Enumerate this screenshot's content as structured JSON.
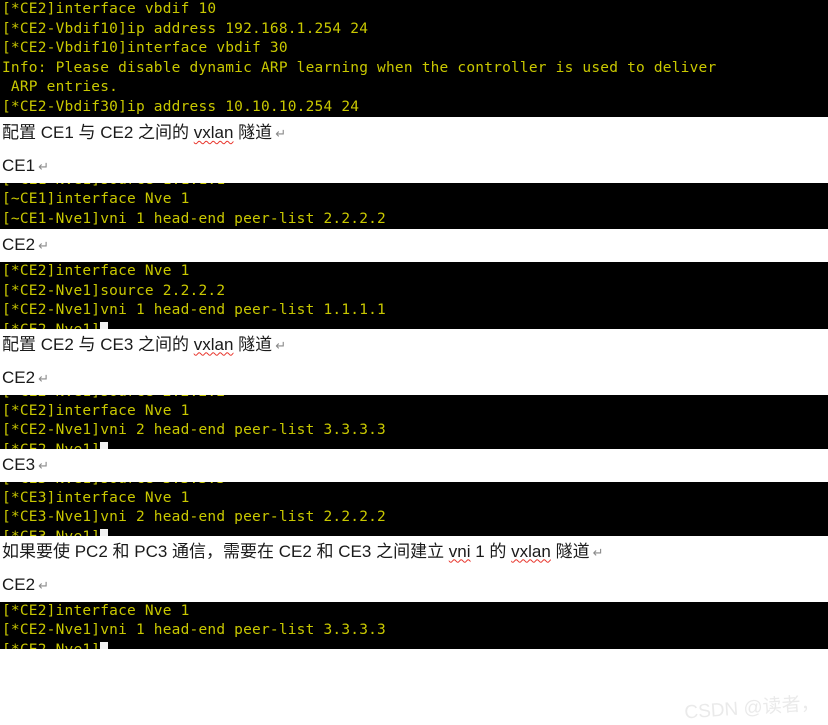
{
  "page": {
    "title": "VXLAN tunnel configuration notes",
    "background": "#ffffff",
    "terminal_bg": "#000000",
    "terminal_fg": "#c9c800",
    "spellcheck_color": "#e8332a",
    "watermark_color": "#e9e9e9"
  },
  "blocks": [
    {
      "type": "terminal",
      "name": "terminal-ce2-vbdif",
      "lines": [
        "[*CE2]interface vbdif 10",
        "[*CE2-Vbdif10]ip address 192.168.1.254 24",
        "[*CE2-Vbdif10]interface vbdif 30",
        "Info: Please disable dynamic ARP learning when the controller is used to deliver",
        " ARP entries.",
        "[*CE2-Vbdif30]ip address 10.10.10.254 24"
      ]
    },
    {
      "type": "prose",
      "name": "prose-ce1-ce2-tunnel",
      "paragraphs": [
        {
          "segments": [
            {
              "text": "配置 CE1 与 CE2 之间的 ",
              "spell": false
            },
            {
              "text": "vxlan",
              "spell": true
            },
            {
              "text": " 隧道",
              "spell": false
            }
          ],
          "pilcrow": "↵"
        },
        {
          "segments": [
            {
              "text": "CE1",
              "spell": false
            }
          ],
          "pilcrow": "↵"
        }
      ]
    },
    {
      "type": "terminal",
      "name": "terminal-ce1-nve",
      "clip_top": true,
      "clip_top_text": "[~CE1-Nve1]source 1.1.1.1",
      "lines": [
        "[~CE1]interface Nve 1",
        "[~CE1-Nve1]vni 1 head-end peer-list 2.2.2.2"
      ]
    },
    {
      "type": "prose",
      "name": "prose-label-ce2-a",
      "paragraphs": [
        {
          "segments": [
            {
              "text": "CE2",
              "spell": false
            }
          ],
          "pilcrow": "↵"
        }
      ]
    },
    {
      "type": "terminal",
      "name": "terminal-ce2-nve1",
      "lines": [
        "[*CE2]interface Nve 1",
        "[*CE2-Nve1]source 2.2.2.2",
        "[*CE2-Nve1]vni 1 head-end peer-list 1.1.1.1"
      ],
      "clip_bottom": true,
      "clip_bottom_text": "[*CE2-Nve1]",
      "caret": true
    },
    {
      "type": "prose",
      "name": "prose-ce2-ce3-tunnel",
      "paragraphs": [
        {
          "segments": [
            {
              "text": "配置 CE2 与 CE3 之间的 ",
              "spell": false
            },
            {
              "text": "vxlan",
              "spell": true
            },
            {
              "text": " 隧道",
              "spell": false
            }
          ],
          "pilcrow": "↵"
        },
        {
          "segments": [
            {
              "text": "CE2",
              "spell": false
            }
          ],
          "pilcrow": "↵"
        }
      ]
    },
    {
      "type": "terminal",
      "name": "terminal-ce2-nve-vni2",
      "clip_top": true,
      "clip_top_text": "[*CE2-Nve1]source 2.2.2.2",
      "lines": [
        "[*CE2]interface Nve 1",
        "[*CE2-Nve1]vni 2 head-end peer-list 3.3.3.3"
      ],
      "clip_bottom": true,
      "clip_bottom_text": "[*CE2-Nve1]",
      "caret": true
    },
    {
      "type": "prose",
      "name": "prose-label-ce3",
      "paragraphs": [
        {
          "segments": [
            {
              "text": "CE3",
              "spell": false
            }
          ],
          "pilcrow": "↵"
        }
      ]
    },
    {
      "type": "terminal",
      "name": "terminal-ce3-nve-vni2",
      "clip_top": true,
      "clip_top_text": "[*CE3-Nve1]source 3.3.3.3",
      "lines": [
        "[*CE3]interface Nve 1",
        "[*CE3-Nve1]vni 2 head-end peer-list 2.2.2.2"
      ],
      "clip_bottom": true,
      "clip_bottom_text": "[*CE3-Nve1]",
      "caret": true
    },
    {
      "type": "prose",
      "name": "prose-pc2-pc3-note",
      "paragraphs": [
        {
          "segments": [
            {
              "text": "如果要使 PC2 和 PC3 通信，需要在 CE2 和 CE3 之间建立 ",
              "spell": false
            },
            {
              "text": "vni",
              "spell": true
            },
            {
              "text": " 1 的 ",
              "spell": false
            },
            {
              "text": "vxlan",
              "spell": true
            },
            {
              "text": " 隧道",
              "spell": false
            }
          ],
          "pilcrow": "↵"
        },
        {
          "segments": [
            {
              "text": "CE2",
              "spell": false
            }
          ],
          "pilcrow": "↵"
        }
      ]
    },
    {
      "type": "terminal",
      "name": "terminal-ce2-nve-vni1-peer3",
      "lines": [
        "[*CE2]interface Nve 1",
        "[*CE2-Nve1]vni 1 head-end peer-list 3.3.3.3"
      ],
      "clip_bottom": true,
      "clip_bottom_text": "[*CE2-Nve1]",
      "caret": true
    }
  ],
  "watermark": {
    "text": "CSDN @读者，"
  }
}
